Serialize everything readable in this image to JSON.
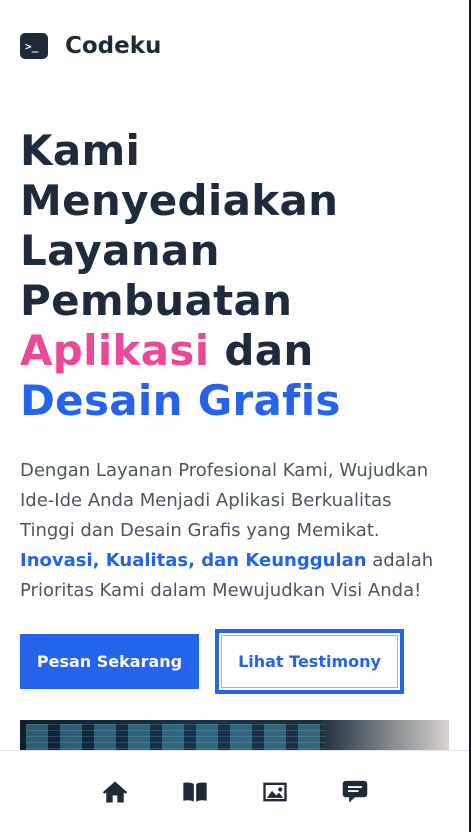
{
  "brand": {
    "name": "Codeku",
    "logo_icon": "terminal-icon",
    "logo_glyph": ">_"
  },
  "hero": {
    "title_lines": [
      "Kami",
      "Menyediakan",
      "Layanan",
      "Pembuatan"
    ],
    "title_accent_pink": "Aplikasi",
    "title_connector": " dan",
    "title_accent_blue": "Desain Grafis",
    "description_lines": [
      "Dengan Layanan Profesional Kami, Wujudkan",
      "Ide-Ide Anda Menjadi Aplikasi Berkualitas",
      "Tinggi dan Desain Grafis yang Memikat."
    ],
    "description_highlight": "Inovasi, Kualitas, dan Keunggulan",
    "description_after_highlight": " adalah",
    "description_last_line": "Prioritas Kami dalam Mewujudkan Visi Anda!"
  },
  "buttons": {
    "primary_label": "Pesan Sekarang",
    "secondary_label": "Lihat Testimony"
  },
  "bottom_nav": {
    "items": [
      {
        "icon": "home-icon"
      },
      {
        "icon": "book-icon"
      },
      {
        "icon": "image-icon"
      },
      {
        "icon": "chat-icon"
      }
    ]
  },
  "colors": {
    "primary": "#2563eb",
    "accent_pink": "#ec4899",
    "text_dark": "#1f2937",
    "text_body": "#4b5563"
  }
}
